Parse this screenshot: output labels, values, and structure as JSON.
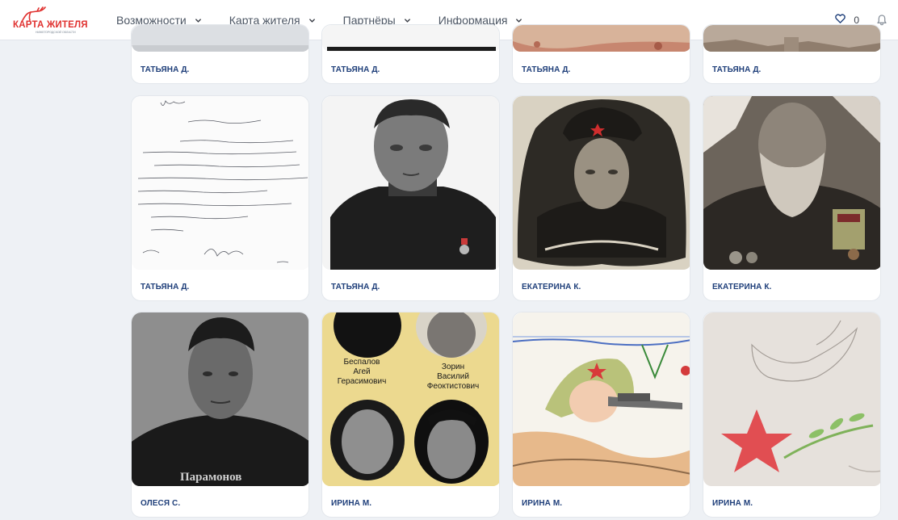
{
  "header": {
    "logo": {
      "text": "КАРТА ЖИТЕЛЯ",
      "subtitle": "НИЖЕГОРОДСКОЙ ОБЛАСТИ",
      "icon": "deer-logo-icon"
    },
    "nav": [
      {
        "label": "Возможности"
      },
      {
        "label": "Карта жителя"
      },
      {
        "label": "Партнёры"
      },
      {
        "label": "Информация"
      }
    ],
    "favorites_count": "0",
    "icons": {
      "favorites": "heart-icon",
      "notifications": "bell-icon",
      "chevron": "chevron-down-icon"
    }
  },
  "colors": {
    "accent": "#e0312f",
    "author": "#1f3f7a",
    "background": "#eef1f5",
    "heart": "#1f3f7a"
  },
  "cards": [
    {
      "author": "ТАТЬЯНА Д.",
      "image": "old photograph (cropped)"
    },
    {
      "author": "ТАТЬЯНА Д.",
      "image": "old photograph (cropped)"
    },
    {
      "author": "ТАТЬЯНА Д.",
      "image": "old photograph (cropped)"
    },
    {
      "author": "ТАТЬЯНА Д.",
      "image": "old photograph (cropped)"
    },
    {
      "author": "ТАТЬЯНА Д.",
      "image": "handwritten letter"
    },
    {
      "author": "ТАТЬЯНА Д.",
      "image": "black and white portrait of a man"
    },
    {
      "author": "ЕКАТЕРИНА К.",
      "image": "sepia portrait of a soldier in cap"
    },
    {
      "author": "ЕКАТЕРИНА К.",
      "image": "portrait of bearded man with medals"
    },
    {
      "author": "ОЛЕСЯ С.",
      "image": "black and white portrait",
      "caption": "Парамонов"
    },
    {
      "author": "ИРИНА М.",
      "image": "memorial collage",
      "names": [
        "Беспалов",
        "Агей",
        "Герасимович",
        "Зорин",
        "Василий",
        "Феоктистович"
      ]
    },
    {
      "author": "ИРИНА М.",
      "image": "children's drawing of a soldier with rifle"
    },
    {
      "author": "ИРИНА М.",
      "image": "drawing of a dove and red star"
    }
  ]
}
